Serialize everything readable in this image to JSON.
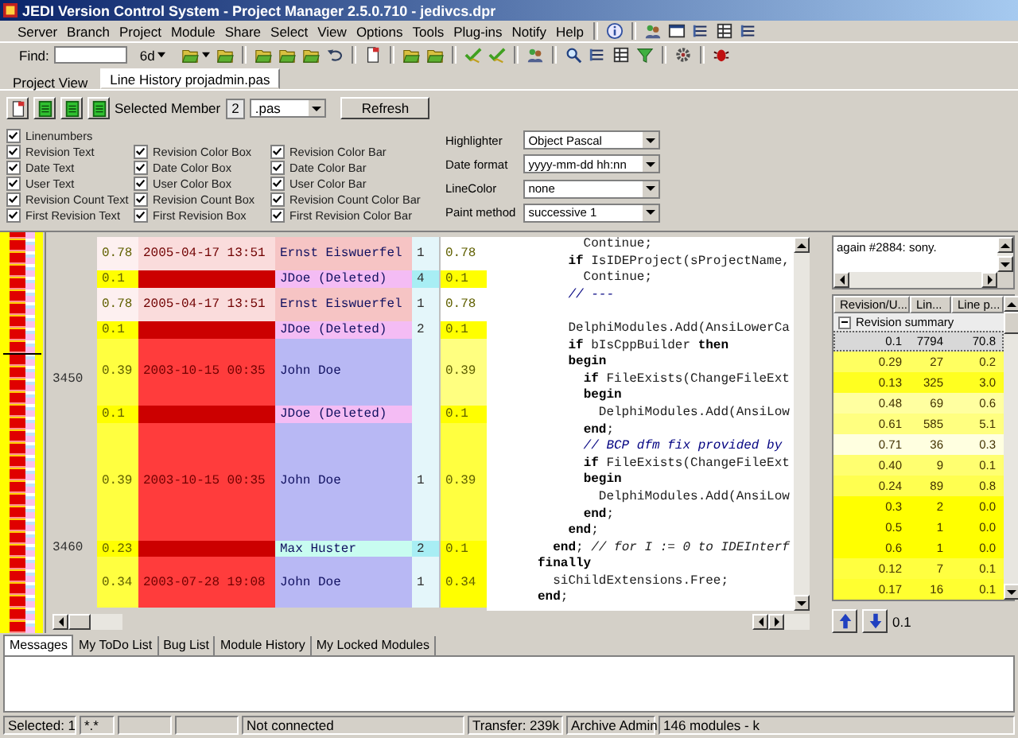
{
  "window": {
    "title": "JEDI Version Control System - Project Manager 2.5.0.710 - jedivcs.dpr"
  },
  "menu": [
    "Server",
    "Branch",
    "Project",
    "Module",
    "Share",
    "Select",
    "View",
    "Options",
    "Tools",
    "Plug-ins",
    "Notify",
    "Help"
  ],
  "toolbar": {
    "find_label": "Find:",
    "age_filter": "6d"
  },
  "tabs": [
    {
      "label": "Project View",
      "selected": false
    },
    {
      "label": "Line History projadmin.pas",
      "selected": true
    }
  ],
  "options": {
    "member_label": "Selected Member",
    "member_count": "2",
    "member_filter": ".pas",
    "refresh": "Refresh",
    "checkbox_columns": [
      [
        {
          "label": "Linenumbers",
          "checked": true
        },
        {
          "label": "Revision Text",
          "checked": true
        },
        {
          "label": "Date Text",
          "checked": true
        },
        {
          "label": "User Text",
          "checked": true
        },
        {
          "label": "Revision Count Text",
          "checked": true
        },
        {
          "label": "First Revision Text",
          "checked": true
        }
      ],
      [
        {
          "label": "Revision Color Box",
          "checked": true
        },
        {
          "label": "Date Color Box",
          "checked": true
        },
        {
          "label": "User Color Box",
          "checked": true
        },
        {
          "label": "Revision Count Box",
          "checked": true
        },
        {
          "label": "First Revision Box",
          "checked": true
        }
      ],
      [
        {
          "label": "Revision Color Bar",
          "checked": true
        },
        {
          "label": "Date Color Bar",
          "checked": true
        },
        {
          "label": "User Color Bar",
          "checked": true
        },
        {
          "label": "Revision Count Color Bar",
          "checked": true
        },
        {
          "label": "First Revision Color Bar",
          "checked": true
        }
      ]
    ],
    "settings": [
      {
        "label": "Highlighter",
        "value": "Object Pascal"
      },
      {
        "label": "Date format",
        "value": "yyyy-mm-dd hh:nn"
      },
      {
        "label": "LineColor",
        "value": "none"
      },
      {
        "label": "Paint method",
        "value": "successive 1"
      }
    ]
  },
  "history": {
    "rows": [
      {
        "revision": {
          "text": "0.78",
          "color": "#fdf0f0"
        },
        "date": {
          "text": "2005-04-17 13:51",
          "color": "#fadcdc"
        },
        "user": {
          "text": "Ernst Eiswuerfel",
          "color": "#f6c4c4"
        },
        "count": {
          "text": "1",
          "color": "#e4f6fa"
        },
        "first_revision": {
          "text": "0.78",
          "color": "#ffffff"
        },
        "lines": [
          {
            "kind": "code",
            "text": "      Continue;"
          },
          {
            "kind": "code",
            "text": "    **if** IsIDEProject(sProjectName,"
          }
        ]
      },
      {
        "revision": {
          "text": "0.1",
          "color": "#ffff00"
        },
        "date": {
          "color": "#cc0000"
        },
        "user": {
          "text": "JDoe (Deleted)",
          "color": "#f4bcf4"
        },
        "count": {
          "text": "4",
          "color": "#a8eef4"
        },
        "first_revision": {
          "text": "0.1",
          "color": "#ffff00"
        },
        "lines": [
          {
            "kind": "code",
            "text": "      Continue;"
          }
        ]
      },
      {
        "revision": {
          "text": "0.78",
          "color": "#fdf0f0"
        },
        "date": {
          "text": "2005-04-17 13:51",
          "color": "#fadcdc"
        },
        "user": {
          "text": "Ernst Eiswuerfel",
          "color": "#f6c4c4"
        },
        "count": {
          "text": "1",
          "color": "#e4f6fa"
        },
        "first_revision": {
          "text": "0.78",
          "color": "#ffffff"
        },
        "lines": [
          {
            "kind": "comment",
            "text": "    // ---"
          },
          {
            "kind": "blank"
          }
        ]
      },
      {
        "revision": {
          "text": "0.1",
          "color": "#ffff00"
        },
        "date": {
          "color": "#cc0000"
        },
        "user": {
          "text": "JDoe (Deleted)",
          "color": "#f4bcf4"
        },
        "count": {
          "text": "2",
          "color": "#e4f6fa"
        },
        "first_revision": {
          "text": "0.1",
          "color": "#ffff00"
        },
        "lines": [
          {
            "kind": "code",
            "text": "    DelphiModules.Add(AnsiLowerCa"
          }
        ]
      },
      {
        "revision": {
          "text": "0.39",
          "color": "#ffff40"
        },
        "date": {
          "text": "2003-10-15 00:35",
          "color": "#ff3c3c"
        },
        "user": {
          "text": "John Doe",
          "color": "#b8b8f4"
        },
        "first_revision": {
          "text": "0.39",
          "color": "#ffff80"
        },
        "lines": [
          {
            "kind": "code",
            "text": "    **if** bIsCppBuilder **then**"
          },
          {
            "kind": "code",
            "text": "    **begin**"
          },
          {
            "kind": "code",
            "text": "      **if** FileExists(ChangeFileExt",
            "line_number": "3450"
          },
          {
            "kind": "code",
            "text": "      **begin**"
          }
        ]
      },
      {
        "revision": {
          "text": "0.1",
          "color": "#ffff00"
        },
        "date": {
          "color": "#cc0000"
        },
        "user": {
          "text": "JDoe (Deleted)",
          "color": "#f4bcf4"
        },
        "first_revision": {
          "text": "0.1",
          "color": "#ffff00"
        },
        "lines": [
          {
            "kind": "code",
            "text": "        DelphiModules.Add(AnsiLow"
          }
        ]
      },
      {
        "revision": {
          "text": "0.39",
          "color": "#ffff40"
        },
        "date": {
          "text": "2003-10-15 00:35",
          "color": "#ff3c3c"
        },
        "user": {
          "text": "John Doe",
          "color": "#b8b8f4"
        },
        "count": {
          "text": "1",
          "color": "#e4f6fa"
        },
        "first_revision": {
          "text": "0.39",
          "color": "#ffff40"
        },
        "lines": [
          {
            "kind": "code",
            "text": "      **end**;"
          },
          {
            "kind": "comment",
            "text": "      // BCP dfm fix provided by"
          },
          {
            "kind": "code",
            "text": "      **if** FileExists(ChangeFileExt"
          },
          {
            "kind": "code",
            "text": "      **begin**"
          },
          {
            "kind": "code",
            "text": "        DelphiModules.Add(AnsiLow"
          },
          {
            "kind": "code",
            "text": "      **end**;"
          },
          {
            "kind": "code",
            "text": "    **end**;"
          }
        ]
      },
      {
        "revision": {
          "text": "0.23",
          "color": "#ffff00"
        },
        "date": {
          "color": "#cc0000"
        },
        "user": {
          "text": "Max Huster",
          "color": "#c8fcf0"
        },
        "count": {
          "text": "2",
          "color": "#a8eef4"
        },
        "first_revision": {
          "text": "0.1",
          "color": "#ffff00"
        },
        "lines": [
          {
            "kind": "code",
            "text": "  **end**; *// for I := 0 to IDEInterf*",
            "line_number": "3460"
          }
        ]
      },
      {
        "revision": {
          "text": "0.34",
          "color": "#ffff40"
        },
        "date": {
          "text": "2003-07-28 19:08",
          "color": "#ff3c3c"
        },
        "user": {
          "text": "John Doe",
          "color": "#b8b8f4"
        },
        "count": {
          "text": "1",
          "color": "#e4f6fa"
        },
        "first_revision": {
          "text": "0.34",
          "color": "#ffff00"
        },
        "lines": [
          {
            "kind": "code",
            "text": "**finally**"
          },
          {
            "kind": "code",
            "text": "  siChildExtensions.Free;"
          },
          {
            "kind": "code",
            "text": "**end**;"
          }
        ]
      }
    ]
  },
  "message": "again #2884: sony.",
  "summary": {
    "columns": [
      "Revision/U...",
      "Lin...",
      "Line p..."
    ],
    "group": "Revision summary",
    "rows": [
      {
        "cells": [
          "0.1",
          "7794",
          "70.8"
        ],
        "selected": true,
        "color": "#d8d8d8"
      },
      {
        "cells": [
          "0.29",
          "27",
          "0.2"
        ],
        "selected": false,
        "color": "#ffff60"
      },
      {
        "cells": [
          "0.13",
          "325",
          "3.0"
        ],
        "selected": false,
        "color": "#ffff20"
      },
      {
        "cells": [
          "0.48",
          "69",
          "0.6"
        ],
        "selected": false,
        "color": "#ffffa0"
      },
      {
        "cells": [
          "0.61",
          "585",
          "5.1"
        ],
        "selected": false,
        "color": "#ffff80"
      },
      {
        "cells": [
          "0.71",
          "36",
          "0.3"
        ],
        "selected": false,
        "color": "#ffffe0"
      },
      {
        "cells": [
          "0.40",
          "9",
          "0.1"
        ],
        "selected": false,
        "color": "#ffff70"
      },
      {
        "cells": [
          "0.24",
          "89",
          "0.8"
        ],
        "selected": false,
        "color": "#ffff50"
      },
      {
        "cells": [
          "0.3",
          "2",
          "0.0"
        ],
        "selected": false,
        "color": "#ffff00"
      },
      {
        "cells": [
          "0.5",
          "1",
          "0.0"
        ],
        "selected": false,
        "color": "#ffff00"
      },
      {
        "cells": [
          "0.6",
          "1",
          "0.0"
        ],
        "selected": false,
        "color": "#ffff00"
      },
      {
        "cells": [
          "0.12",
          "7",
          "0.1"
        ],
        "selected": false,
        "color": "#ffff40"
      },
      {
        "cells": [
          "0.17",
          "16",
          "0.1"
        ],
        "selected": false,
        "color": "#ffff30"
      }
    ]
  },
  "summary_nav": "0.1",
  "bottom_tabs": [
    {
      "label": "Messages",
      "selected": true
    },
    {
      "label": "My ToDo List",
      "selected": false
    },
    {
      "label": "Bug List",
      "selected": false
    },
    {
      "label": "Module History",
      "selected": false
    },
    {
      "label": "My Locked Modules",
      "selected": false
    }
  ],
  "status_bar": [
    "Selected: 1",
    "*.*",
    "Not connected",
    "Transfer: 239k",
    "Archive Admin",
    "146 modules - k"
  ]
}
